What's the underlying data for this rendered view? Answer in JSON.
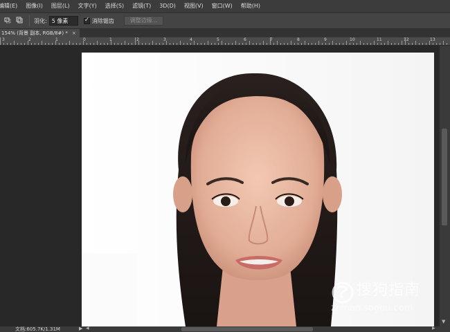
{
  "menu": {
    "items": [
      "编辑(E)",
      "图像(I)",
      "图层(L)",
      "文字(Y)",
      "选择(S)",
      "滤镜(T)",
      "3D(D)",
      "视图(V)",
      "窗口(W)",
      "帮助(H)"
    ]
  },
  "options": {
    "feather_label": "羽化:",
    "feather_value": "5 像素",
    "antialias_label": "消除锯齿",
    "refine_edge_label": "调整边缘..."
  },
  "document": {
    "tab_title": "154% (背景 副本, RGB/8#) *",
    "close_glyph": "×"
  },
  "ruler": {
    "labels": [
      "3",
      "2",
      "1",
      "0",
      "1",
      "2",
      "3",
      "4",
      "5",
      "6",
      "7",
      "8",
      "9",
      "10",
      "11",
      "12",
      "13"
    ]
  },
  "status": {
    "doc_size": "文档:605.7K/1.31M"
  },
  "watermark": {
    "title": "搜狗指南",
    "url": "zhinan.sogou.com"
  },
  "icons": {
    "menu_overflow": "more-icon",
    "selection_mode": "selection-mode-icon",
    "add_selection": "add-to-selection-icon"
  }
}
